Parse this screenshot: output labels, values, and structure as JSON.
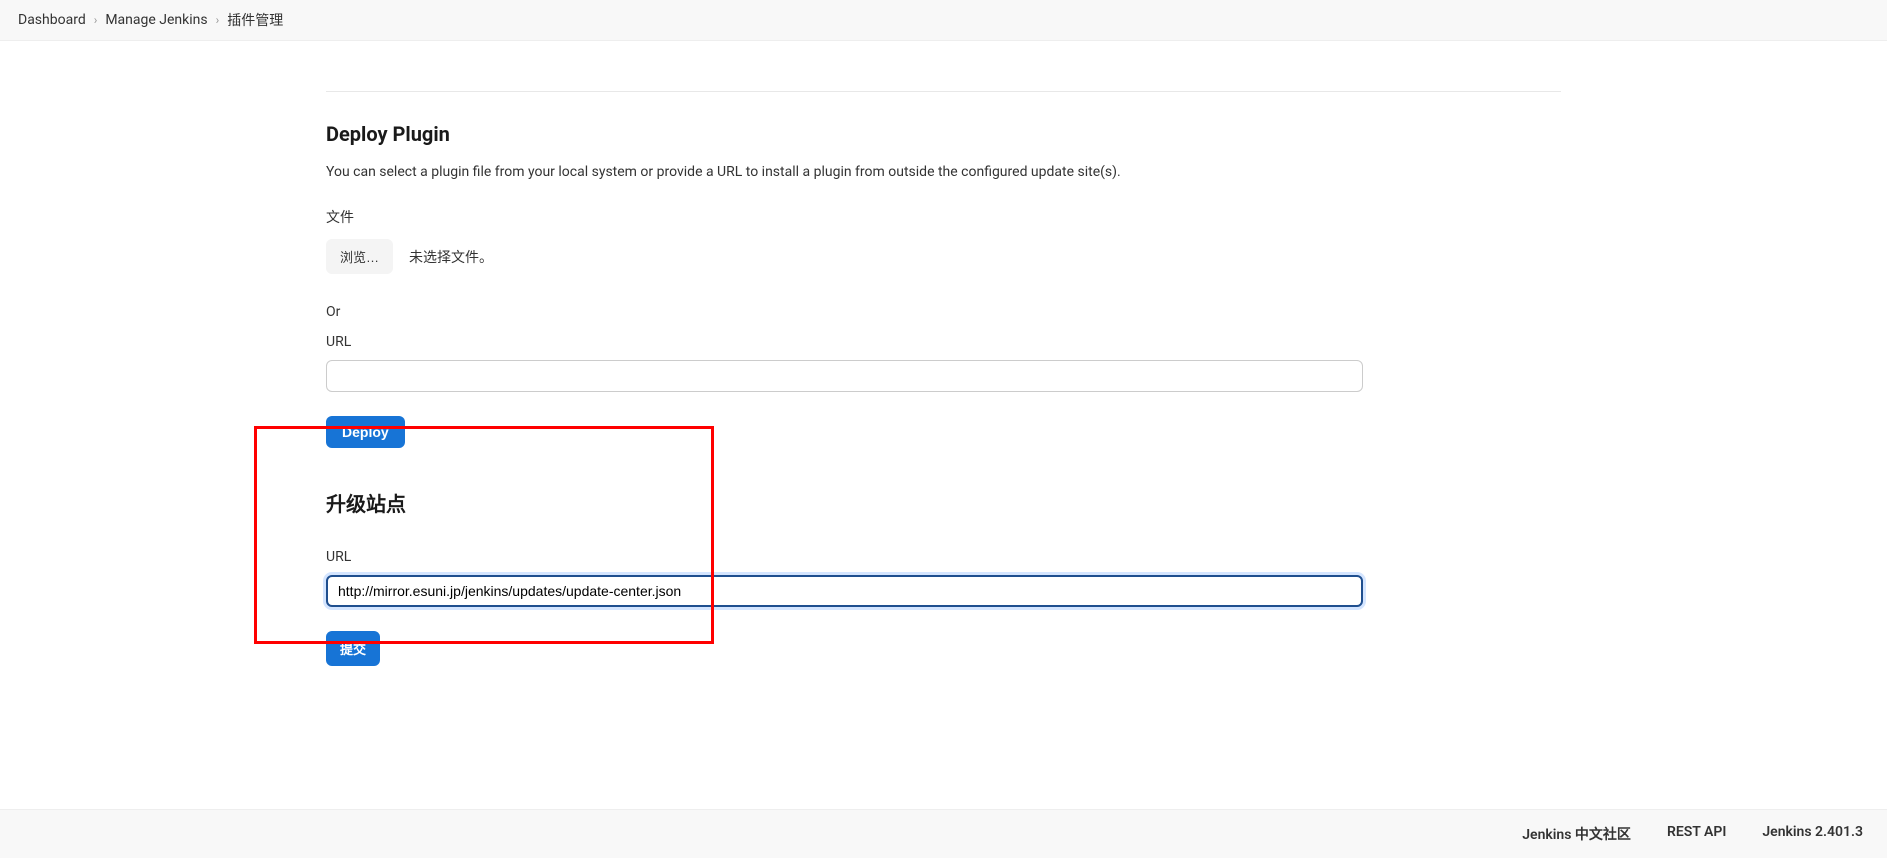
{
  "breadcrumb": {
    "items": [
      {
        "label": "Dashboard"
      },
      {
        "label": "Manage Jenkins"
      },
      {
        "label": "插件管理"
      }
    ]
  },
  "deploy": {
    "heading": "Deploy Plugin",
    "description": "You can select a plugin file from your local system or provide a URL to install a plugin from outside the configured update site(s).",
    "file_label": "文件",
    "browse_label": "浏览…",
    "file_status": "未选择文件。",
    "or_label": "Or",
    "url_label": "URL",
    "url_value": "",
    "deploy_button": "Deploy"
  },
  "upgrade": {
    "heading": "升级站点",
    "url_label": "URL",
    "url_value": "http://mirror.esuni.jp/jenkins/updates/update-center.json",
    "submit_button": "提交"
  },
  "footer": {
    "community": "Jenkins 中文社区",
    "rest_api": "REST API",
    "version": "Jenkins 2.401.3"
  }
}
